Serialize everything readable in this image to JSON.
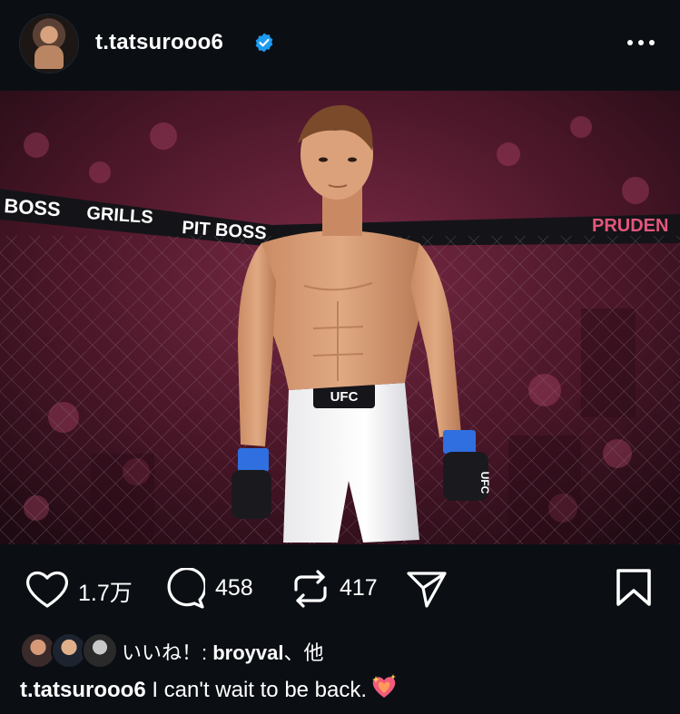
{
  "post": {
    "username": "t.tatsurooo6",
    "verified": true
  },
  "actions": {
    "likes_count": "1.7万",
    "comments_count": "458",
    "reposts_count": "417"
  },
  "liked_by": {
    "prefix": "いいね！: ",
    "name": "broyval",
    "suffix": "、他"
  },
  "caption": {
    "username": "t.tatsurooo6",
    "text": " I can't wait to be back."
  },
  "photo": {
    "ring_banner": [
      "BOSS",
      "GRILLS",
      "PIT BOSS",
      "PRUDEN"
    ],
    "shorts_logo": "UFC",
    "glove_logo": "UFC"
  },
  "colors": {
    "background": "#0b0f14",
    "verified_badge": "#1d9bf0",
    "glove_wrap": "#2f6fe0",
    "banner_accent": "#e3567c"
  },
  "icons": [
    "more-options-icon",
    "verified-badge-icon",
    "heart-icon",
    "comment-icon",
    "repost-icon",
    "share-icon",
    "bookmark-icon",
    "sparkling-heart-emoji"
  ]
}
